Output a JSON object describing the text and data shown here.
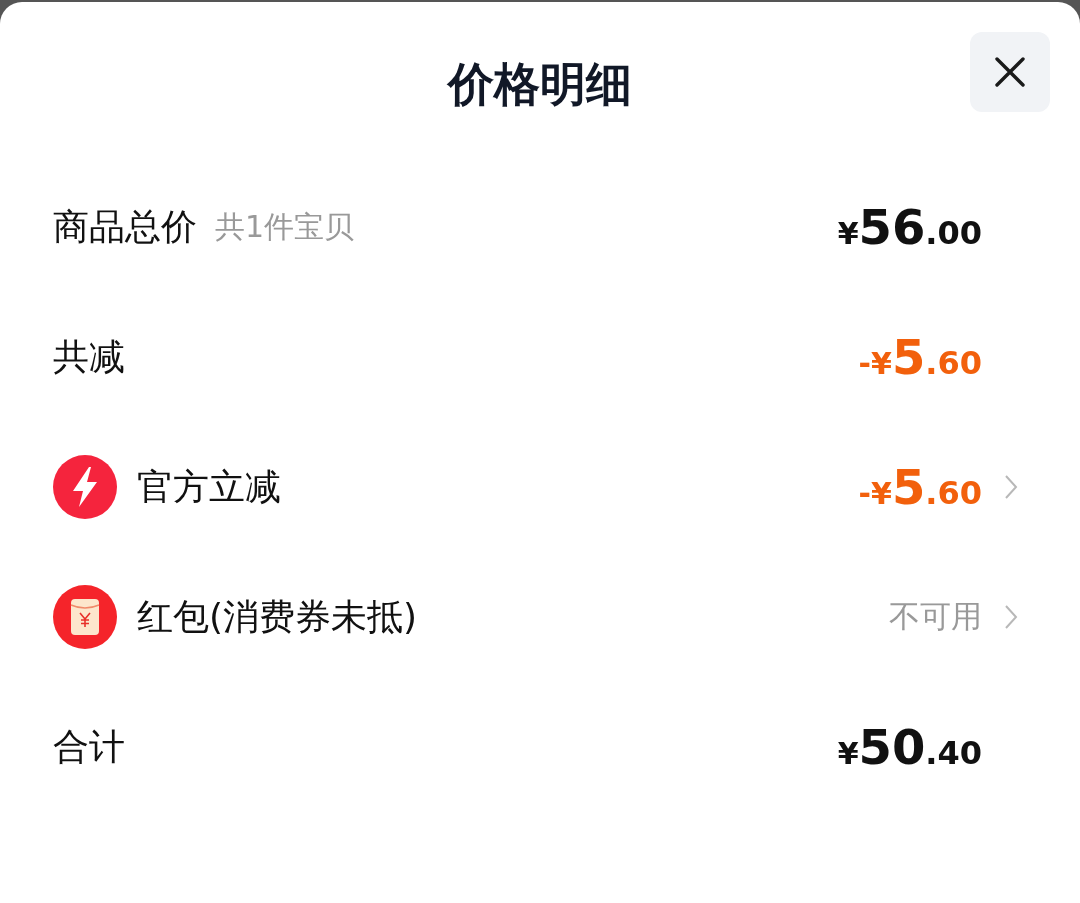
{
  "title": "价格明细",
  "rows": [
    {
      "kind": "plain",
      "label": "商品总价",
      "note": "共1件宝贝",
      "value": {
        "kind": "price",
        "discount": false,
        "prefix": "¥",
        "integer": "56",
        "decimal": ".00"
      }
    },
    {
      "kind": "plain",
      "label": "共减",
      "value": {
        "kind": "price",
        "discount": true,
        "prefix": "-¥",
        "integer": "5",
        "decimal": ".60"
      }
    },
    {
      "kind": "promo",
      "label": "官方立减",
      "value": {
        "kind": "price",
        "discount": true,
        "prefix": "-¥",
        "integer": "5",
        "decimal": ".60"
      },
      "chevron": true
    },
    {
      "kind": "coupon",
      "label": "红包(消费券未抵)",
      "value": {
        "kind": "text",
        "text": "不可用"
      },
      "chevron": true
    },
    {
      "kind": "plain",
      "label": "合计",
      "value": {
        "kind": "price",
        "discount": false,
        "prefix": "¥",
        "integer": "50",
        "decimal": ".40"
      }
    }
  ]
}
